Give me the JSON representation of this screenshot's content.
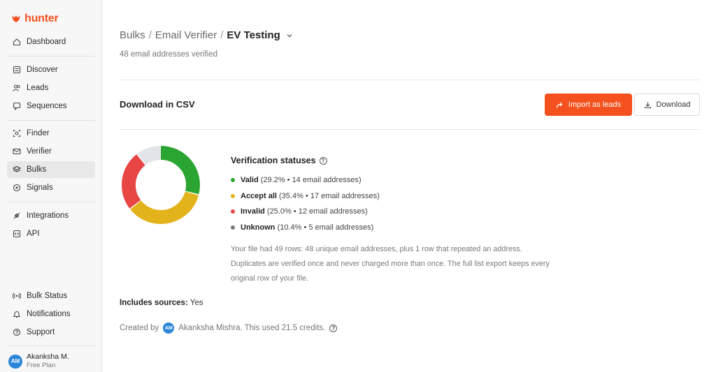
{
  "brand": {
    "name": "hunter",
    "color": "#f4511e"
  },
  "sidebar": {
    "items": [
      {
        "id": "dashboard",
        "label": "Dashboard",
        "icon": "home-icon"
      },
      {
        "id": "discover",
        "label": "Discover",
        "icon": "list-icon"
      },
      {
        "id": "leads",
        "label": "Leads",
        "icon": "users-icon"
      },
      {
        "id": "sequences",
        "label": "Sequences",
        "icon": "message-icon"
      },
      {
        "id": "finder",
        "label": "Finder",
        "icon": "target-icon"
      },
      {
        "id": "verifier",
        "label": "Verifier",
        "icon": "mail-check-icon"
      },
      {
        "id": "bulks",
        "label": "Bulks",
        "icon": "layers-icon",
        "active": true
      },
      {
        "id": "signals",
        "label": "Signals",
        "icon": "signal-icon"
      },
      {
        "id": "integrations",
        "label": "Integrations",
        "icon": "plug-icon"
      },
      {
        "id": "api",
        "label": "API",
        "icon": "code-icon"
      },
      {
        "id": "bulk-status",
        "label": "Bulk Status",
        "icon": "broadcast-icon"
      },
      {
        "id": "notifications",
        "label": "Notifications",
        "icon": "bell-icon"
      },
      {
        "id": "support",
        "label": "Support",
        "icon": "help-icon"
      }
    ],
    "user": {
      "initials": "AM",
      "name": "Akanksha M.",
      "plan": "Free Plan"
    }
  },
  "breadcrumb": {
    "part1": "Bulks",
    "part2": "Email Verifier",
    "current": "EV Testing"
  },
  "subtitle": "48 email addresses verified",
  "csv": {
    "title": "Download in CSV",
    "import_label": "Import as leads",
    "download_label": "Download"
  },
  "statuses": {
    "title": "Verification statuses",
    "items": [
      {
        "label": "Valid",
        "detail": "(29.2% • 14 email addresses)",
        "percent": 29.2,
        "color": "#2ba532"
      },
      {
        "label": "Accept all",
        "detail": "(35.4% • 17 email addresses)",
        "percent": 35.4,
        "color": "#e3b31c"
      },
      {
        "label": "Invalid",
        "detail": "(25.0% • 12 email addresses)",
        "percent": 25.0,
        "color": "#e84545"
      },
      {
        "label": "Unknown",
        "detail": "(10.4% • 5 email addresses)",
        "percent": 10.4,
        "color": "#e1e5ea"
      }
    ],
    "unknown_dot_color": "#777777"
  },
  "description": "Your file had 49 rows: 48 unique email addresses, plus 1 row that repeated an address. Duplicates are verified once and never charged more than once. The full list export keeps every original row of your file.",
  "sources": {
    "label": "Includes sources:",
    "value": "Yes"
  },
  "created": {
    "prefix": "Created by",
    "initials": "AM",
    "text": "Akanksha Mishra. This used 21.5 credits."
  }
}
